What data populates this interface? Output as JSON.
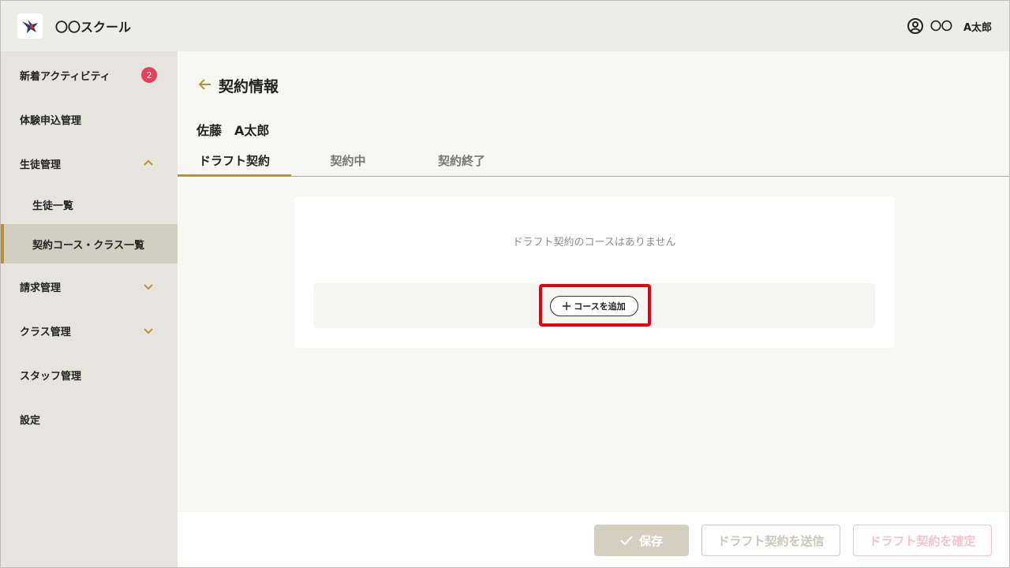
{
  "header": {
    "brand": "〇〇スクール",
    "user_org": "〇〇",
    "user_name": "A太郎"
  },
  "sidebar": {
    "items": [
      {
        "label": "新着アクティビティ",
        "badge": "2"
      },
      {
        "label": "体験申込管理"
      },
      {
        "label": "生徒管理",
        "expanded": true
      },
      {
        "label": "生徒一覧"
      },
      {
        "label": "契約コース・クラス一覧",
        "active": true
      },
      {
        "label": "請求管理",
        "expanded": false
      },
      {
        "label": "クラス管理",
        "expanded": false
      },
      {
        "label": "スタッフ管理"
      },
      {
        "label": "設定"
      }
    ]
  },
  "main": {
    "title": "契約情報",
    "student_name": "佐藤　A太郎",
    "tabs": [
      {
        "label": "ドラフト契約",
        "active": true
      },
      {
        "label": "契約中"
      },
      {
        "label": "契約終了"
      }
    ],
    "empty_message": "ドラフト契約のコースはありません",
    "add_course_label": "コースを追加"
  },
  "footer": {
    "save_label": "保存",
    "send_label": "ドラフト契約を送信",
    "confirm_label": "ドラフト契約を確定"
  },
  "colors": {
    "accent": "#b9913a",
    "badge": "#e5415a",
    "highlight": "#e5000f"
  }
}
